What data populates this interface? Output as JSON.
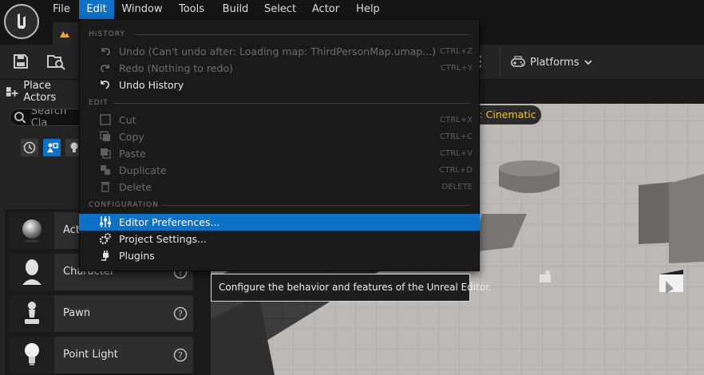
{
  "menubar": {
    "items": [
      {
        "label": "File"
      },
      {
        "label": "Edit"
      },
      {
        "label": "Window"
      },
      {
        "label": "Tools"
      },
      {
        "label": "Build"
      },
      {
        "label": "Select"
      },
      {
        "label": "Actor"
      },
      {
        "label": "Help"
      }
    ],
    "active": "Edit"
  },
  "toolbar": {
    "platforms_label": "Platforms"
  },
  "left_panel": {
    "title": "Place Actors",
    "search_placeholder": "Search Cla",
    "actors": [
      {
        "label": "Act",
        "icon": "sphere-icon"
      },
      {
        "label": "Character",
        "icon": "character-icon"
      },
      {
        "label": "Pawn",
        "icon": "pawn-icon"
      },
      {
        "label": "Point Light",
        "icon": "lightbulb-icon"
      }
    ]
  },
  "viewport": {
    "cinematic_badge": "y: Cinematic"
  },
  "edit_menu": {
    "sections": {
      "history": "HISTORY",
      "edit": "EDIT",
      "configuration": "CONFIGURATION"
    },
    "items": [
      {
        "label": "Undo (Can't undo after: Loading map: ThirdPersonMap.umap...)",
        "shortcut": "CTRL+Z",
        "enabled": false,
        "icon": "undo-icon"
      },
      {
        "label": "Redo (Nothing to redo)",
        "shortcut": "CTRL+Y",
        "enabled": false,
        "icon": "redo-icon"
      },
      {
        "label": "Undo History",
        "shortcut": "",
        "enabled": true,
        "icon": "undo-history-icon"
      },
      {
        "label": "Cut",
        "shortcut": "CTRL+X",
        "enabled": false,
        "icon": "cut-icon"
      },
      {
        "label": "Copy",
        "shortcut": "CTRL+C",
        "enabled": false,
        "icon": "copy-icon"
      },
      {
        "label": "Paste",
        "shortcut": "CTRL+V",
        "enabled": false,
        "icon": "paste-icon"
      },
      {
        "label": "Duplicate",
        "shortcut": "CTRL+D",
        "enabled": false,
        "icon": "duplicate-icon"
      },
      {
        "label": "Delete",
        "shortcut": "DELETE",
        "enabled": false,
        "icon": "delete-icon"
      },
      {
        "label": "Editor Preferences...",
        "shortcut": "",
        "enabled": true,
        "highlighted": true,
        "icon": "sliders-icon"
      },
      {
        "label": "Project Settings...",
        "shortcut": "",
        "enabled": true,
        "icon": "gears-icon"
      },
      {
        "label": "Plugins",
        "shortcut": "",
        "enabled": true,
        "icon": "plug-icon"
      }
    ]
  },
  "tooltip": {
    "text": "Configure the behavior and features of the Unreal Editor."
  },
  "colors": {
    "accent": "#0e70c7",
    "cinematic": "#f5c518",
    "menu_bg": "#1a1a1a"
  }
}
